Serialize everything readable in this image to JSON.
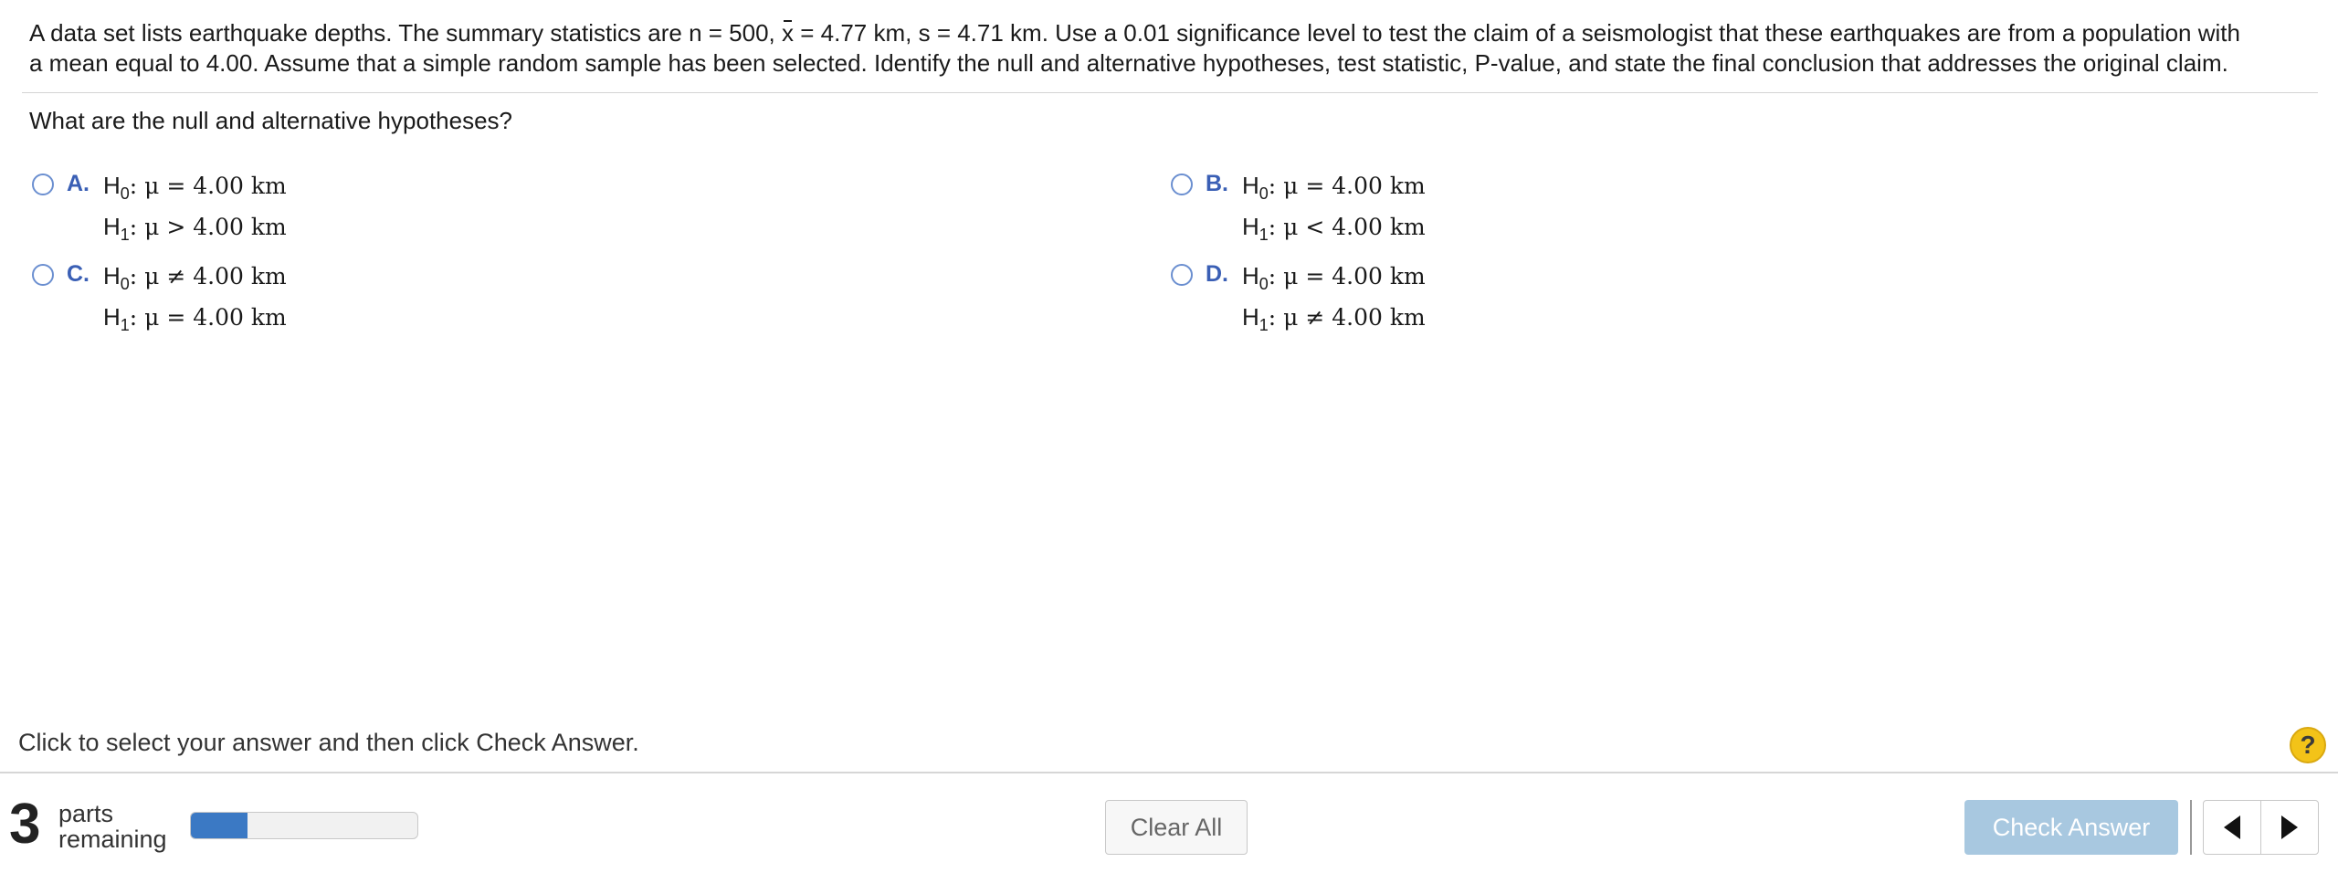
{
  "question": {
    "part1": "A data set lists earthquake depths. The summary statistics are n = 500,",
    "xbar_symbol": "x",
    "part2": "= 4.77 km, s = 4.71 km. Use a 0.01 significance level to test the claim of a seismologist that these earthquakes are from a population with a mean equal to 4.00. Assume that a simple random sample has been selected. Identify the null and alternative hypotheses, test statistic, P-value, and state the final conclusion that addresses the original claim."
  },
  "prompt": "What are the null and alternative hypotheses?",
  "options": [
    {
      "letter": "A.",
      "h0": {
        "H": "H",
        "sub": "0",
        "rest": ": μ = 4.00 km"
      },
      "h1": {
        "H": "H",
        "sub": "1",
        "rest": ": μ > 4.00 km"
      }
    },
    {
      "letter": "B.",
      "h0": {
        "H": "H",
        "sub": "0",
        "rest": ": μ = 4.00 km"
      },
      "h1": {
        "H": "H",
        "sub": "1",
        "rest": ": μ < 4.00 km"
      }
    },
    {
      "letter": "C.",
      "h0": {
        "H": "H",
        "sub": "0",
        "rest": ": μ ≠ 4.00 km"
      },
      "h1": {
        "H": "H",
        "sub": "1",
        "rest": ": μ = 4.00 km"
      }
    },
    {
      "letter": "D.",
      "h0": {
        "H": "H",
        "sub": "0",
        "rest": ": μ = 4.00 km"
      },
      "h1": {
        "H": "H",
        "sub": "1",
        "rest": ": μ ≠ 4.00 km"
      }
    }
  ],
  "instruction": "Click to select your answer and then click Check Answer.",
  "help_label": "?",
  "footer": {
    "parts_count": "3",
    "parts_line1": "parts",
    "parts_line2": "remaining",
    "progress_fraction": 0.25,
    "clear_all_label": "Clear All",
    "check_answer_label": "Check Answer",
    "prev_icon": "triangle-left-icon",
    "next_icon": "triangle-right-icon"
  },
  "colors": {
    "option_letter": "#3a5fb5",
    "radio_border": "#6b8fd0",
    "progress_fill": "#3b79c4",
    "check_button_bg": "#a8c8e0",
    "help_bg": "#f3c318"
  }
}
